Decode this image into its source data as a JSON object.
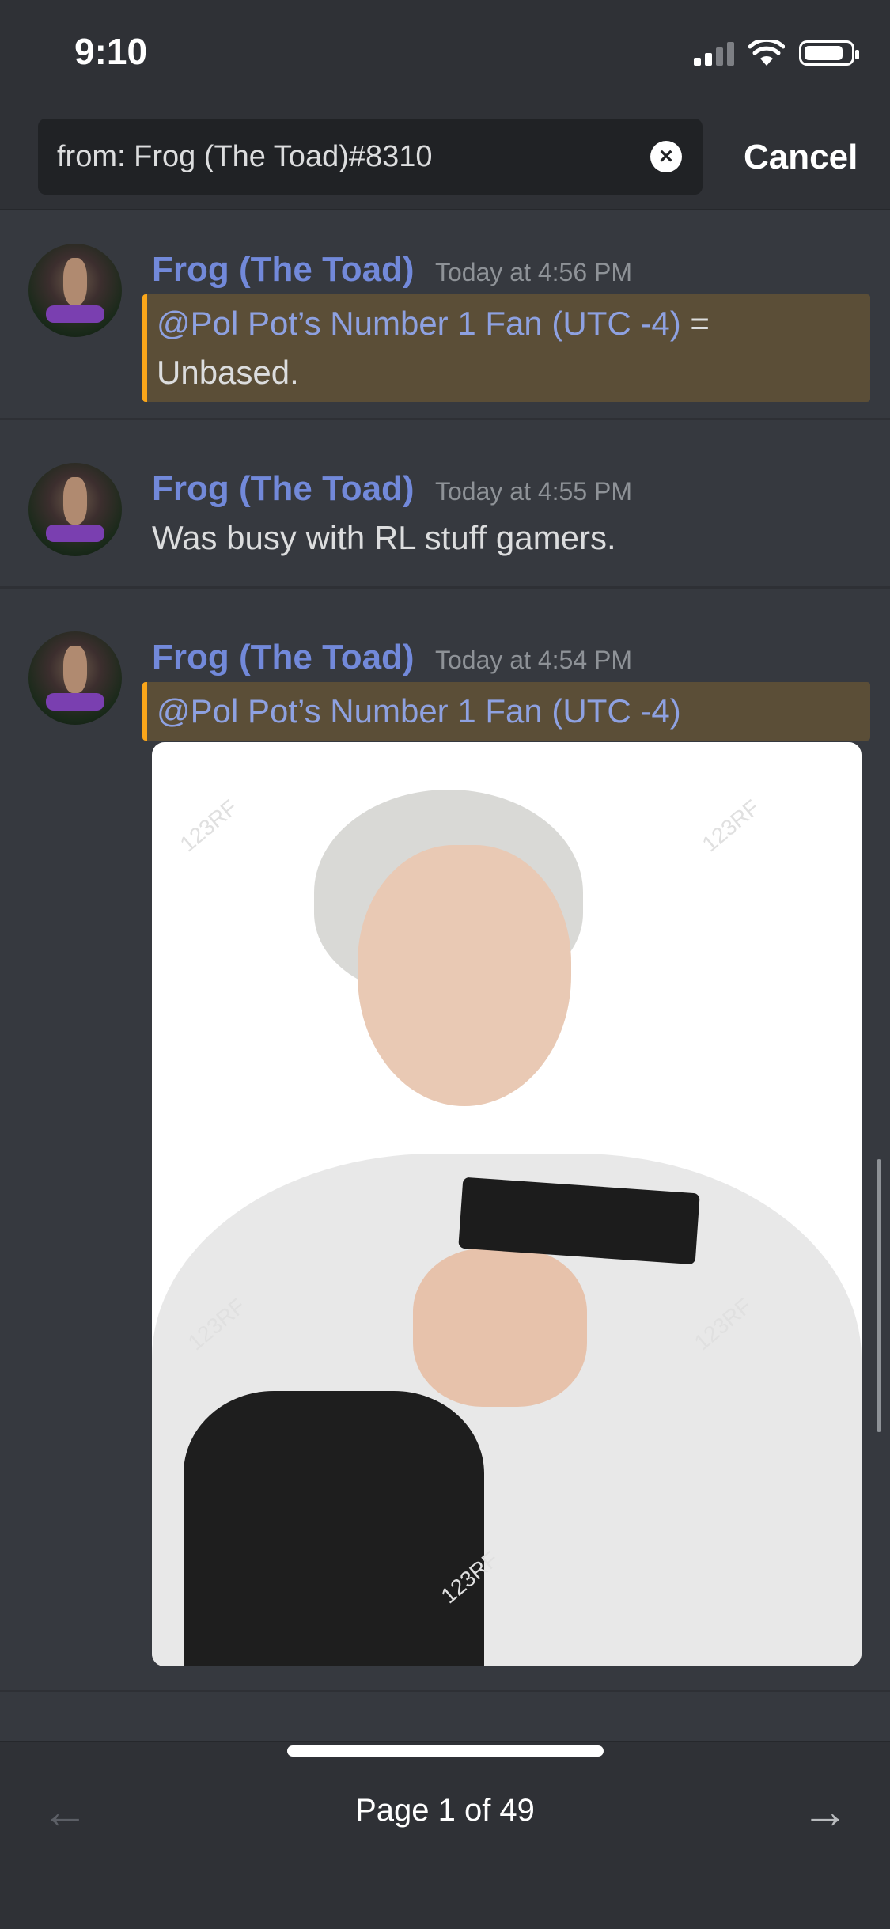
{
  "status_bar": {
    "time": "9:10",
    "battery_level": 0.85
  },
  "search": {
    "query": "from: Frog (The Toad)#8310",
    "cancel_label": "Cancel"
  },
  "messages": [
    {
      "username": "Frog (The Toad)",
      "timestamp": "Today at 4:56 PM",
      "mention": "@Pol Pot’s Number 1 Fan (UTC -4)",
      "text_after_mention": " =",
      "text_line2": "Unbased."
    },
    {
      "username": "Frog (The Toad)",
      "timestamp": "Today at 4:55 PM",
      "text": "Was busy with RL stuff gamers."
    },
    {
      "username": "Frog (The Toad)",
      "timestamp": "Today at 4:54 PM",
      "mention": "@Pol Pot’s Number 1 Fan (UTC -4)",
      "attachment": {
        "watermark": "123RF"
      }
    }
  ],
  "pagination": {
    "label": "Page 1 of 49",
    "prev_icon": "arrow-left-icon",
    "next_icon": "arrow-right-icon"
  },
  "colors": {
    "mention_bg": "#5b4e37",
    "mention_border": "#faa61a",
    "username": "#7289da",
    "background": "#36393f"
  }
}
